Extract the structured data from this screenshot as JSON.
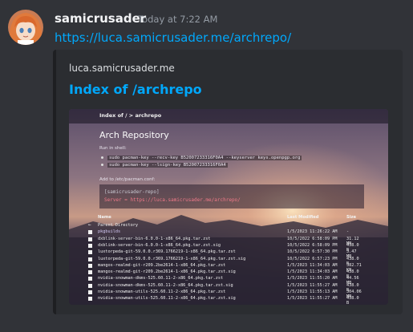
{
  "message": {
    "username": "samicrusader",
    "timestamp": "Today at 7:22 AM",
    "link": "https://luca.samicrusader.me/archrepo/"
  },
  "embed": {
    "provider": "luca.samicrusader.me",
    "title": "Index of /archrepo",
    "accent_color": "#1e1f22"
  },
  "preview": {
    "breadcrumb": "Index of  /  >  archrepo",
    "heading": "Arch Repository",
    "run_label": "Run in shell:",
    "commands": [
      "sudo pacman-key --recv-key B52007233316F0A4 --keyserver keys.openpgp.org",
      "sudo pacman-key --lsign-key B52007233316F0A4"
    ],
    "add_label": "Add to /etc/pacman.conf:",
    "conf_lines": [
      "[samicrusader-repo]",
      "Server = https://luca.samicrusader.me/archrepo/"
    ],
    "columns": {
      "name": "Name",
      "modified": "Last Modified",
      "size": "Size"
    },
    "rows": [
      {
        "name": "Parent Directory",
        "date": "",
        "size": "",
        "kind": "up"
      },
      {
        "name": "pkgbuilds",
        "date": "1/5/2023 11:26:22 AM",
        "size": "-",
        "kind": "dir"
      },
      {
        "name": "dxblink-server-bin-6.0.0-1-x86_64.pkg.tar.zst",
        "date": "10/5/2022 6:58:09 PM",
        "size": "31.12 MB",
        "kind": "file"
      },
      {
        "name": "dxblink-server-bin-6.0.0-1-x86_64.pkg.tar.zst.sig",
        "date": "10/5/2022 6:58:09 PM",
        "size": "438.0 B",
        "kind": "file"
      },
      {
        "name": "luxtorpeda-git-59.0.0.r369.1766219-1-x86_64.pkg.tar.zst",
        "date": "10/5/2022 6:57:30 PM",
        "size": "3.47 MB",
        "kind": "file"
      },
      {
        "name": "luxtorpeda-git-59.0.0.r369.1766219-1-x86_64.pkg.tar.zst.sig",
        "date": "10/5/2022 6:57:23 PM",
        "size": "438.0 B",
        "kind": "file"
      },
      {
        "name": "mangos-realmd-git-r209.2be2614-1-x86_64.pkg.tar.zst",
        "date": "1/5/2023 11:34:03 AM",
        "size": "382.71 KB",
        "kind": "file"
      },
      {
        "name": "mangos-realmd-git-r209.2be2614-1-x86_64.pkg.tar.zst.sig",
        "date": "1/5/2023 11:34:03 AM",
        "size": "438.0 B",
        "kind": "file"
      },
      {
        "name": "nvidia-snowman-dkms-525.60.11-2-x86_64.pkg.tar.zst",
        "date": "1/5/2023 11:55:20 AM",
        "size": "44.56 MB",
        "kind": "file"
      },
      {
        "name": "nvidia-snowman-dkms-525.60.11-2-x86_64.pkg.tar.zst.sig",
        "date": "1/5/2023 11:55:27 AM",
        "size": "438.0 B",
        "kind": "file"
      },
      {
        "name": "nvidia-snowman-utils-525.60.11-2-x86_64.pkg.tar.zst",
        "date": "1/5/2023 11:55:13 AM",
        "size": "304.06 MB",
        "kind": "file"
      },
      {
        "name": "nvidia-snowman-utils-525.60.11-2-x86_64.pkg.tar.zst.sig",
        "date": "1/5/2023 11:55:27 AM",
        "size": "438.0 B",
        "kind": "file"
      }
    ]
  }
}
